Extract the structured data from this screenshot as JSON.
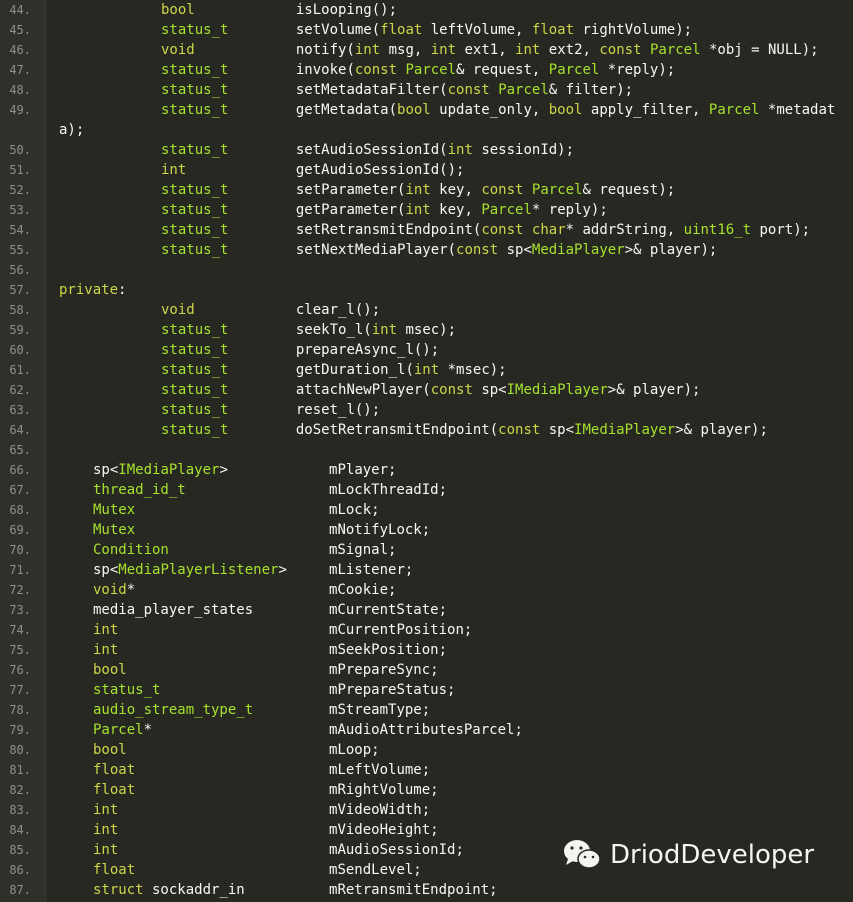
{
  "colors": {
    "background": "#272822",
    "keyword": "#cdd64a",
    "type": "#a6e22e",
    "text": "#f8f8f2",
    "line_number": "#8f908a"
  },
  "lines": [
    {
      "n": "44.",
      "indent": 3,
      "parts": [
        [
          "bool",
          "k"
        ],
        [
          "            isLooping();",
          ""
        ]
      ]
    },
    {
      "n": "45.",
      "indent": 3,
      "parts": [
        [
          "status_t",
          "t"
        ],
        [
          "        setVolume(",
          ""
        ],
        [
          "float",
          "k"
        ],
        [
          " leftVolume, ",
          ""
        ],
        [
          "float",
          "k"
        ],
        [
          " rightVolume);",
          ""
        ]
      ]
    },
    {
      "n": "46.",
      "indent": 3,
      "parts": [
        [
          "void",
          "k"
        ],
        [
          "            notify(",
          ""
        ],
        [
          "int",
          "k"
        ],
        [
          " msg, ",
          ""
        ],
        [
          "int",
          "k"
        ],
        [
          " ext1, ",
          ""
        ],
        [
          "int",
          "k"
        ],
        [
          " ext2, ",
          ""
        ],
        [
          "const",
          "k"
        ],
        [
          " ",
          ""
        ],
        [
          "Parcel",
          "t"
        ],
        [
          " *obj = NULL);",
          ""
        ]
      ]
    },
    {
      "n": "47.",
      "indent": 3,
      "parts": [
        [
          "status_t",
          "t"
        ],
        [
          "        invoke(",
          ""
        ],
        [
          "const",
          "k"
        ],
        [
          " ",
          ""
        ],
        [
          "Parcel",
          "t"
        ],
        [
          "& request, ",
          ""
        ],
        [
          "Parcel",
          "t"
        ],
        [
          " *reply);",
          ""
        ]
      ]
    },
    {
      "n": "48.",
      "indent": 3,
      "parts": [
        [
          "status_t",
          "t"
        ],
        [
          "        setMetadataFilter(",
          ""
        ],
        [
          "const",
          "k"
        ],
        [
          " ",
          ""
        ],
        [
          "Parcel",
          "t"
        ],
        [
          "& filter);",
          ""
        ]
      ]
    },
    {
      "n": "49.",
      "indent": 3,
      "parts": [
        [
          "status_t",
          "t"
        ],
        [
          "        getMetadata(",
          ""
        ],
        [
          "bool",
          "k"
        ],
        [
          " update_only, ",
          ""
        ],
        [
          "bool",
          "k"
        ],
        [
          " apply_filter, ",
          ""
        ],
        [
          "Parcel",
          "t"
        ],
        [
          " *metadat",
          ""
        ]
      ]
    },
    {
      "n": "",
      "indent": 0,
      "parts": [
        [
          "a);",
          ""
        ]
      ]
    },
    {
      "n": "50.",
      "indent": 3,
      "parts": [
        [
          "status_t",
          "t"
        ],
        [
          "        setAudioSessionId(",
          ""
        ],
        [
          "int",
          "k"
        ],
        [
          " sessionId);",
          ""
        ]
      ]
    },
    {
      "n": "51.",
      "indent": 3,
      "parts": [
        [
          "int",
          "k"
        ],
        [
          "             getAudioSessionId();",
          ""
        ]
      ]
    },
    {
      "n": "52.",
      "indent": 3,
      "parts": [
        [
          "status_t",
          "t"
        ],
        [
          "        setParameter(",
          ""
        ],
        [
          "int",
          "k"
        ],
        [
          " key, ",
          ""
        ],
        [
          "const",
          "k"
        ],
        [
          " ",
          ""
        ],
        [
          "Parcel",
          "t"
        ],
        [
          "& request);",
          ""
        ]
      ]
    },
    {
      "n": "53.",
      "indent": 3,
      "parts": [
        [
          "status_t",
          "t"
        ],
        [
          "        getParameter(",
          ""
        ],
        [
          "int",
          "k"
        ],
        [
          " key, ",
          ""
        ],
        [
          "Parcel",
          "t"
        ],
        [
          "* reply);",
          ""
        ]
      ]
    },
    {
      "n": "54.",
      "indent": 3,
      "parts": [
        [
          "status_t",
          "t"
        ],
        [
          "        setRetransmitEndpoint(",
          ""
        ],
        [
          "const",
          "k"
        ],
        [
          " ",
          ""
        ],
        [
          "char",
          "k"
        ],
        [
          "* addrString, ",
          ""
        ],
        [
          "uint16_t",
          "t"
        ],
        [
          " port);",
          ""
        ]
      ]
    },
    {
      "n": "55.",
      "indent": 3,
      "parts": [
        [
          "status_t",
          "t"
        ],
        [
          "        setNextMediaPlayer(",
          ""
        ],
        [
          "const",
          "k"
        ],
        [
          " sp<",
          ""
        ],
        [
          "MediaPlayer",
          "t"
        ],
        [
          ">& player);",
          ""
        ]
      ]
    },
    {
      "n": "56.",
      "indent": 0,
      "parts": []
    },
    {
      "n": "57.",
      "indent": 0,
      "parts": [
        [
          "private",
          "k"
        ],
        [
          ":",
          ""
        ]
      ]
    },
    {
      "n": "58.",
      "indent": 3,
      "parts": [
        [
          "void",
          "k"
        ],
        [
          "            clear_l();",
          ""
        ]
      ]
    },
    {
      "n": "59.",
      "indent": 3,
      "parts": [
        [
          "status_t",
          "t"
        ],
        [
          "        seekTo_l(",
          ""
        ],
        [
          "int",
          "k"
        ],
        [
          " msec);",
          ""
        ]
      ]
    },
    {
      "n": "60.",
      "indent": 3,
      "parts": [
        [
          "status_t",
          "t"
        ],
        [
          "        prepareAsync_l();",
          ""
        ]
      ]
    },
    {
      "n": "61.",
      "indent": 3,
      "parts": [
        [
          "status_t",
          "t"
        ],
        [
          "        getDuration_l(",
          ""
        ],
        [
          "int",
          "k"
        ],
        [
          " *msec);",
          ""
        ]
      ]
    },
    {
      "n": "62.",
      "indent": 3,
      "parts": [
        [
          "status_t",
          "t"
        ],
        [
          "        attachNewPlayer(",
          ""
        ],
        [
          "const",
          "k"
        ],
        [
          " sp<",
          ""
        ],
        [
          "IMediaPlayer",
          "t"
        ],
        [
          ">& player);",
          ""
        ]
      ]
    },
    {
      "n": "63.",
      "indent": 3,
      "parts": [
        [
          "status_t",
          "t"
        ],
        [
          "        reset_l();",
          ""
        ]
      ]
    },
    {
      "n": "64.",
      "indent": 3,
      "parts": [
        [
          "status_t",
          "t"
        ],
        [
          "        doSetRetransmitEndpoint(",
          ""
        ],
        [
          "const",
          "k"
        ],
        [
          " sp<",
          ""
        ],
        [
          "IMediaPlayer",
          "t"
        ],
        [
          ">& player);",
          ""
        ]
      ]
    },
    {
      "n": "65.",
      "indent": 0,
      "parts": []
    },
    {
      "n": "66.",
      "indent": 1,
      "parts": [
        [
          "sp<",
          ""
        ],
        [
          "IMediaPlayer",
          "t"
        ],
        [
          ">            mPlayer;",
          ""
        ]
      ]
    },
    {
      "n": "67.",
      "indent": 1,
      "parts": [
        [
          "thread_id_t",
          "t"
        ],
        [
          "                 mLockThreadId;",
          ""
        ]
      ]
    },
    {
      "n": "68.",
      "indent": 1,
      "parts": [
        [
          "Mutex",
          "t"
        ],
        [
          "                       mLock;",
          ""
        ]
      ]
    },
    {
      "n": "69.",
      "indent": 1,
      "parts": [
        [
          "Mutex",
          "t"
        ],
        [
          "                       mNotifyLock;",
          ""
        ]
      ]
    },
    {
      "n": "70.",
      "indent": 1,
      "parts": [
        [
          "Condition",
          "t"
        ],
        [
          "                   mSignal;",
          ""
        ]
      ]
    },
    {
      "n": "71.",
      "indent": 1,
      "parts": [
        [
          "sp<",
          ""
        ],
        [
          "MediaPlayerListener",
          "t"
        ],
        [
          ">     mListener;",
          ""
        ]
      ]
    },
    {
      "n": "72.",
      "indent": 1,
      "parts": [
        [
          "void",
          "k"
        ],
        [
          "*                       mCookie;",
          ""
        ]
      ]
    },
    {
      "n": "73.",
      "indent": 1,
      "parts": [
        [
          "media_player_states         mCurrentState;",
          ""
        ]
      ]
    },
    {
      "n": "74.",
      "indent": 1,
      "parts": [
        [
          "int",
          "k"
        ],
        [
          "                         mCurrentPosition;",
          ""
        ]
      ]
    },
    {
      "n": "75.",
      "indent": 1,
      "parts": [
        [
          "int",
          "k"
        ],
        [
          "                         mSeekPosition;",
          ""
        ]
      ]
    },
    {
      "n": "76.",
      "indent": 1,
      "parts": [
        [
          "bool",
          "k"
        ],
        [
          "                        mPrepareSync;",
          ""
        ]
      ]
    },
    {
      "n": "77.",
      "indent": 1,
      "parts": [
        [
          "status_t",
          "t"
        ],
        [
          "                    mPrepareStatus;",
          ""
        ]
      ]
    },
    {
      "n": "78.",
      "indent": 1,
      "parts": [
        [
          "audio_stream_type_t",
          "t"
        ],
        [
          "         mStreamType;",
          ""
        ]
      ]
    },
    {
      "n": "79.",
      "indent": 1,
      "parts": [
        [
          "Parcel",
          "t"
        ],
        [
          "*                     mAudioAttributesParcel;",
          ""
        ]
      ]
    },
    {
      "n": "80.",
      "indent": 1,
      "parts": [
        [
          "bool",
          "k"
        ],
        [
          "                        mLoop;",
          ""
        ]
      ]
    },
    {
      "n": "81.",
      "indent": 1,
      "parts": [
        [
          "float",
          "k"
        ],
        [
          "                       mLeftVolume;",
          ""
        ]
      ]
    },
    {
      "n": "82.",
      "indent": 1,
      "parts": [
        [
          "float",
          "k"
        ],
        [
          "                       mRightVolume;",
          ""
        ]
      ]
    },
    {
      "n": "83.",
      "indent": 1,
      "parts": [
        [
          "int",
          "k"
        ],
        [
          "                         mVideoWidth;",
          ""
        ]
      ]
    },
    {
      "n": "84.",
      "indent": 1,
      "parts": [
        [
          "int",
          "k"
        ],
        [
          "                         mVideoHeight;",
          ""
        ]
      ]
    },
    {
      "n": "85.",
      "indent": 1,
      "parts": [
        [
          "int",
          "k"
        ],
        [
          "                         mAudioSessionId;",
          ""
        ]
      ]
    },
    {
      "n": "86.",
      "indent": 1,
      "parts": [
        [
          "float",
          "k"
        ],
        [
          "                       mSendLevel;",
          ""
        ]
      ]
    },
    {
      "n": "87.",
      "indent": 1,
      "parts": [
        [
          "struct",
          "k"
        ],
        [
          " sockaddr_in          mRetransmitEndpoint;",
          ""
        ]
      ]
    }
  ],
  "watermark": {
    "icon": "wechat-icon",
    "text": "DriodDeveloper"
  }
}
